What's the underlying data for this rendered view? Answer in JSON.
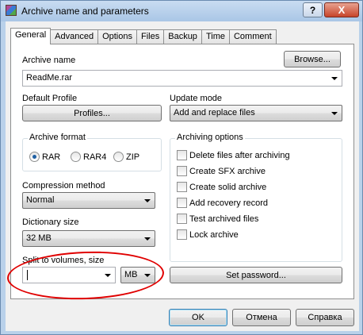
{
  "window": {
    "title": "Archive name and parameters",
    "help_label": "?",
    "close_label": "X"
  },
  "tabs": [
    {
      "label": "General",
      "active": true
    },
    {
      "label": "Advanced",
      "active": false
    },
    {
      "label": "Options",
      "active": false
    },
    {
      "label": "Files",
      "active": false
    },
    {
      "label": "Backup",
      "active": false
    },
    {
      "label": "Time",
      "active": false
    },
    {
      "label": "Comment",
      "active": false
    }
  ],
  "archive_name": {
    "label": "Archive name",
    "value": "ReadMe.rar",
    "browse_label": "Browse..."
  },
  "default_profile": {
    "label": "Default Profile",
    "profiles_label": "Profiles..."
  },
  "update_mode": {
    "label": "Update mode",
    "value": "Add and replace files"
  },
  "archive_format": {
    "label": "Archive format",
    "options": [
      "RAR",
      "RAR4",
      "ZIP"
    ],
    "selected": "RAR"
  },
  "archiving_options": {
    "label": "Archiving options",
    "items": [
      "Delete files after archiving",
      "Create SFX archive",
      "Create solid archive",
      "Add recovery record",
      "Test archived files",
      "Lock archive"
    ]
  },
  "compression_method": {
    "label": "Compression method",
    "value": "Normal"
  },
  "dictionary_size": {
    "label": "Dictionary size",
    "value": "32 MB"
  },
  "split_volumes": {
    "label": "Split to volumes, size",
    "value": "",
    "unit": "MB"
  },
  "set_password_label": "Set password...",
  "buttons": {
    "ok": "OK",
    "cancel": "Отмена",
    "help": "Справка"
  },
  "colors": {
    "annotation": "#e00000",
    "title_bar": "#b9d1ea"
  }
}
